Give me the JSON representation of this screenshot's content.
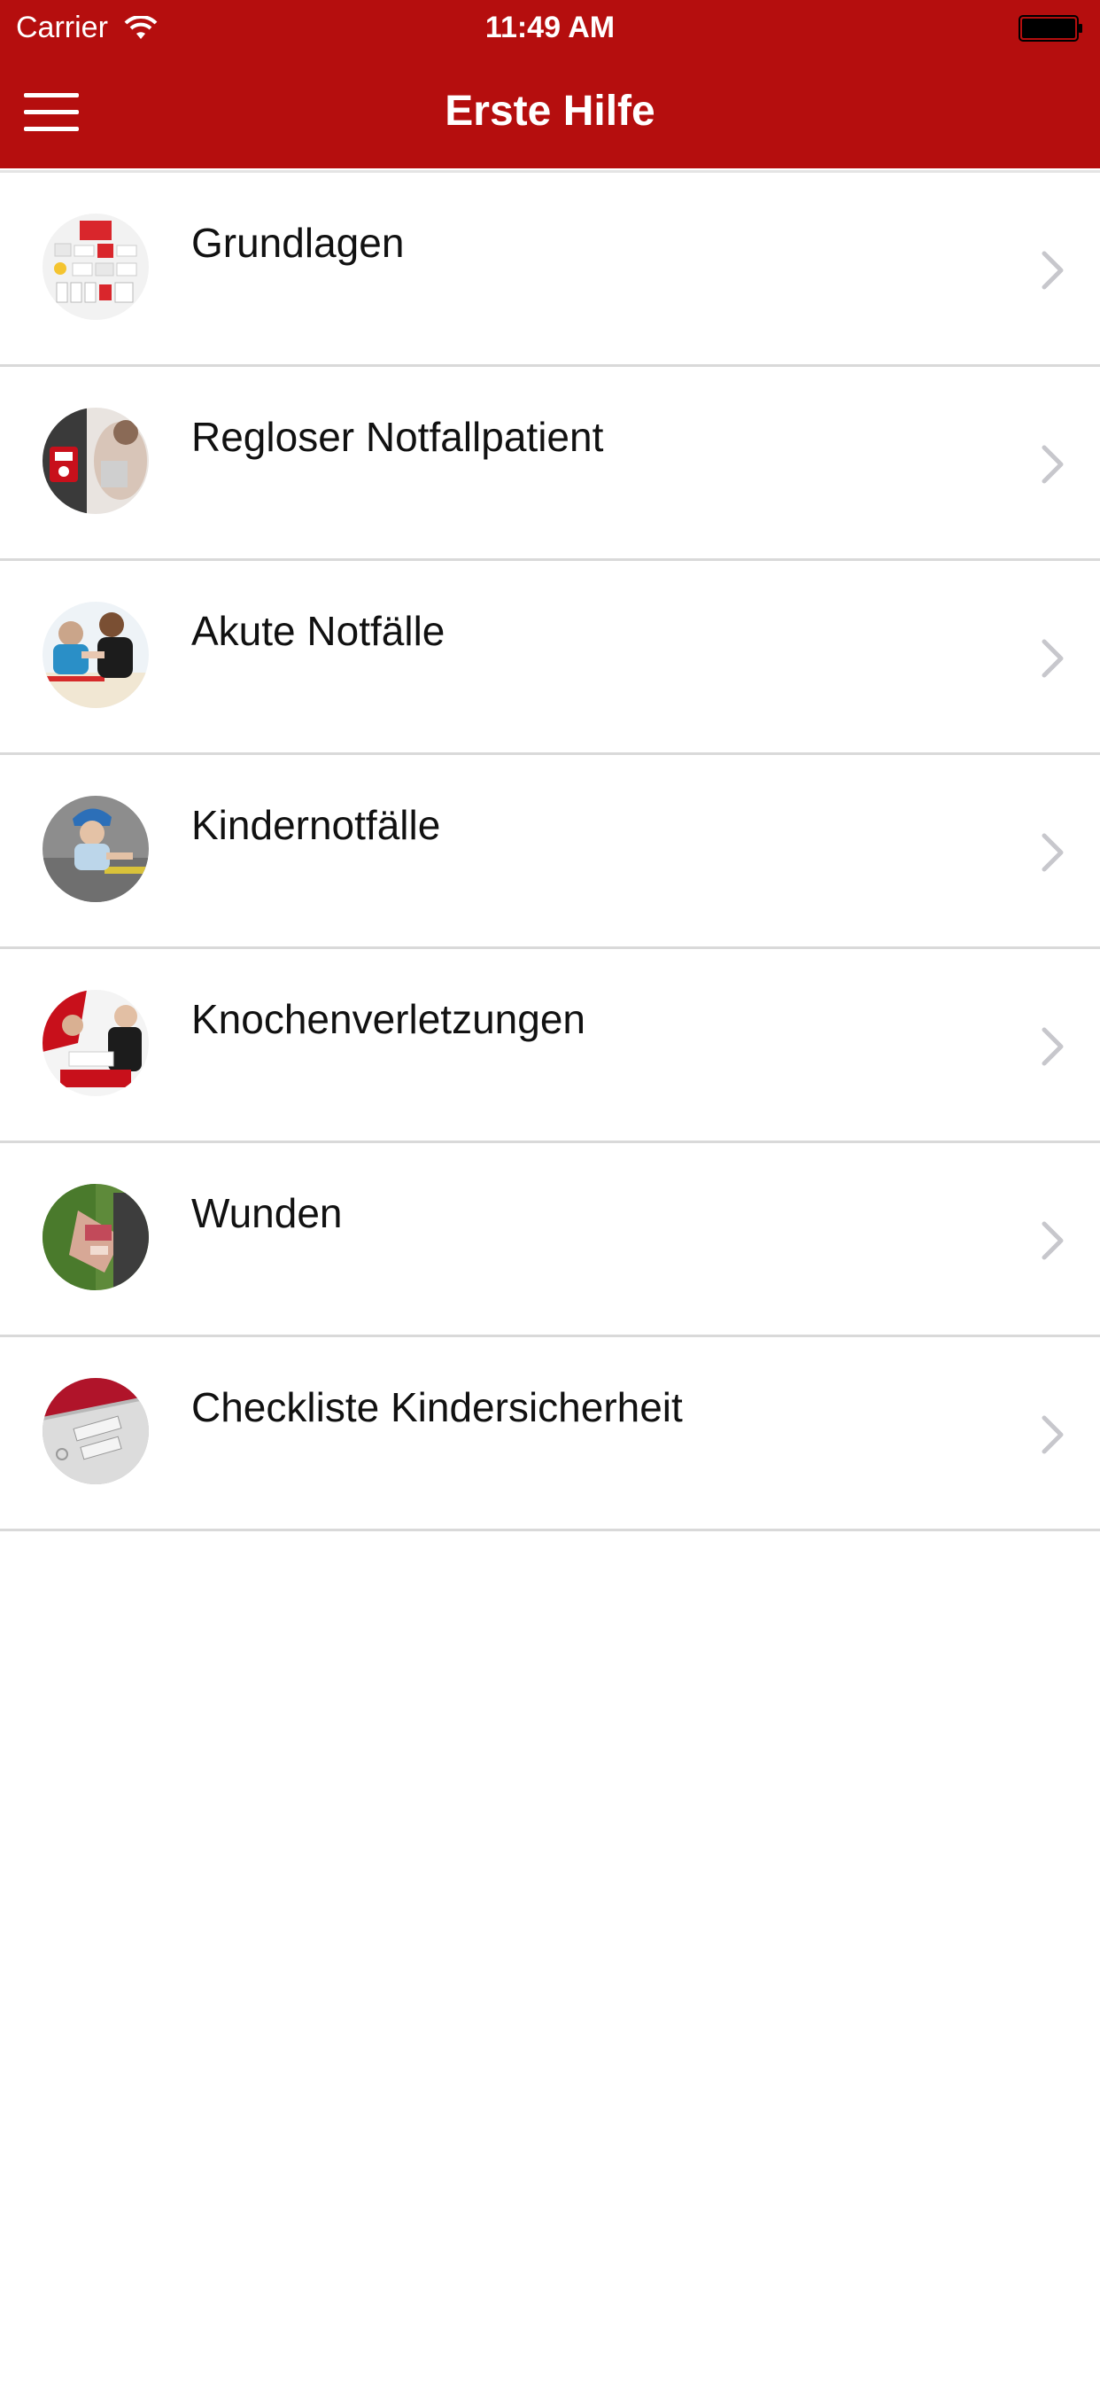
{
  "status_bar": {
    "carrier": "Carrier",
    "time": "11:49 AM"
  },
  "nav_bar": {
    "title": "Erste Hilfe",
    "background_color": "#b50e0e"
  },
  "menu": {
    "items": [
      {
        "label": "Grundlagen",
        "icon": "first-aid-kit-thumbnail"
      },
      {
        "label": "Regloser Notfallpatient",
        "icon": "defibrillator-thumbnail"
      },
      {
        "label": "Akute Notfälle",
        "icon": "helper-thumbnail"
      },
      {
        "label": "Kindernotfälle",
        "icon": "child-helmet-thumbnail"
      },
      {
        "label": "Knochenverletzungen",
        "icon": "bandaging-thumbnail"
      },
      {
        "label": "Wunden",
        "icon": "wound-thumbnail"
      },
      {
        "label": "Checkliste Kindersicherheit",
        "icon": "checklist-thumbnail"
      }
    ]
  }
}
